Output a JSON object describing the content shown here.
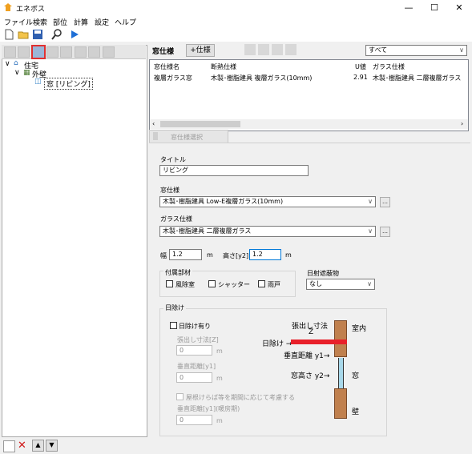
{
  "app": {
    "title": "エネボス",
    "win_minimize": "—",
    "win_maximize": "☐",
    "win_close": "✕"
  },
  "menu": [
    "ファイル",
    "検索",
    "部位",
    "計算",
    "設定",
    "ヘルプ"
  ],
  "tree": {
    "root": "住宅",
    "child": "外壁",
    "leaf": "窓 [リビング]"
  },
  "panel": {
    "header": "窓仕様",
    "add_button": "+仕様",
    "filter_value": "すべて",
    "columns": [
      "窓仕様名",
      "断熱仕様",
      "U値",
      "ガラス仕様"
    ],
    "row": [
      "複層ガラス窓",
      "木製･樹脂建具 複層ガラス(10mm)",
      "2.91",
      "木製･樹脂建具 二層複層ガラス"
    ],
    "tab_label": "窓仕様選択"
  },
  "form": {
    "title_label": "タイトル",
    "title_value": "リビング",
    "spec_label": "窓仕様",
    "spec_value": "木製･樹脂建具 Low-E複層ガラス(10mm)",
    "glass_label": "ガラス仕様",
    "glass_value": "木製･樹脂建具 二層複層ガラス",
    "width_label": "幅",
    "width_value": "1.2",
    "width_unit": "m",
    "height_label": "高さ[y2]",
    "height_value": "1.2",
    "height_unit": "m",
    "parts_label": "付属部材",
    "parts": [
      "風除室",
      "シャッター",
      "雨戸"
    ],
    "shade_label": "日射遮蔽物",
    "shade_value": "なし",
    "eave_group": "日除け",
    "eave_check": "日除け有り",
    "proj_label": "張出し寸法[Z]",
    "proj_value": "0",
    "proj_unit": "m",
    "vert_label": "垂直距離[y1]",
    "vert_value": "0",
    "vert_unit": "m",
    "season_check": "屋根けらば等を期間に応じて考慮する",
    "vert2_label": "垂直距離[y1](暖房期)",
    "vert2_value": "0",
    "vert2_unit": "m"
  },
  "diagram": {
    "proj_text": "張出し寸法",
    "z": "Z",
    "indoor": "室内",
    "eave": "日除け →",
    "vert": "垂直距離 y1→",
    "height": "窓高さ y2→",
    "window": "窓",
    "wall": "壁"
  },
  "colors": {
    "eave_red": "#e8202a",
    "wall_brown": "#c0804e",
    "accent_blue": "#1e6fd6",
    "highlight_red": "#e03030"
  }
}
